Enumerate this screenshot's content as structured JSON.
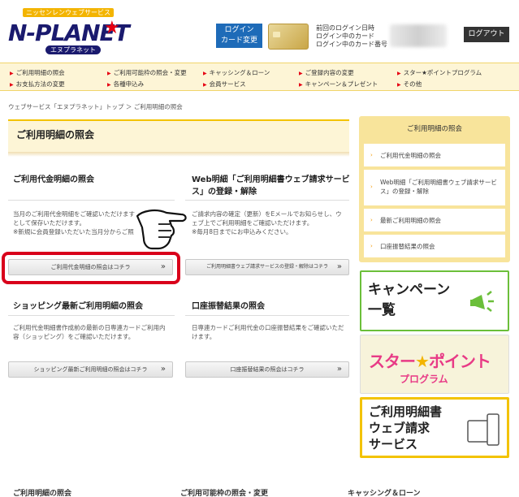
{
  "header": {
    "logo_tag": "ニッセンレンウェブサービス",
    "logo_main": "N-PLANET",
    "logo_sub": "エヌプラネット",
    "login_button": "ログイン\nカード変更",
    "account_info": [
      "前回のログイン日時",
      "ログイン中のカード",
      "ログイン中のカード番号"
    ],
    "logout_button": "ログアウト"
  },
  "nav": [
    {
      "label": "ご利用明細の照会"
    },
    {
      "label": "ご利用可能枠の照会・変更"
    },
    {
      "label": "キャッシング＆ローン"
    },
    {
      "label": "ご登録内容の変更"
    },
    {
      "label": "スター★ポイントプログラム"
    },
    {
      "label": "お支払方法の変更"
    },
    {
      "label": "各種申込み"
    },
    {
      "label": "会員サービス"
    },
    {
      "label": "キャンペーン＆プレゼント"
    },
    {
      "label": "その他"
    }
  ],
  "breadcrumb": "ウェブサービス「エヌプラネット」トップ ＞ ご利用明細の照会",
  "main": {
    "heading": "ご利用明細の照会",
    "sections": [
      {
        "title": "ご利用代金明細の照会",
        "desc": [
          "当月のご利用代金明細をご確認いただけます",
          "として保存いただけます。",
          "※新規に会員登録いただいた当月分からご照"
        ],
        "button": "ご利用代金明細の照会はコチラ"
      },
      {
        "title": "Web明細「ご利用明細書ウェブ請求サービス」の登録・解除",
        "desc": [
          "ご請求内容の確定（更新）をEメールでお知らせし、ウ",
          "ェブ上でご利用明細をご確認いただけます。",
          "※毎月8日までにお申込みください。"
        ],
        "button": "ご利用明細書ウェブ請求サービスの登録・解除はコチラ"
      },
      {
        "title": "ショッピング最新ご利用明細の照会",
        "desc": [
          "ご利用代金明細書作成前の最新の日専連カードご利用内",
          "容（ショッピング）をご確認いただけます。"
        ],
        "button": "ショッピング最新ご利用明細の照会はコチラ"
      },
      {
        "title": "口座振替結果の照会",
        "desc": [
          "日専連カードご利用代金の口座振替結果をご確認いただ",
          "けます。"
        ],
        "button": "口座振替結果の照会はコチラ"
      }
    ]
  },
  "sidebar": {
    "heading": "ご利用明細の照会",
    "items": [
      {
        "label": "ご利用代金明細の照会"
      },
      {
        "label": "Web明細「ご利用明細書ウェブ請求サービス」の登録・解除"
      },
      {
        "label": "最新ご利用明細の照会"
      },
      {
        "label": "口座振替結果の照会"
      }
    ]
  },
  "banners": {
    "campaign": [
      "キャンペーン",
      "一覧"
    ],
    "star_point": {
      "line1a": "スター",
      "line1b": "ポイント",
      "line2": "プログラム"
    },
    "web_bill": [
      "ご利用明細書",
      "ウェブ請求",
      "サービス"
    ]
  },
  "footer": [
    "ご利用明細の照会",
    "ご利用可能枠の照会・変更",
    "キャッシング＆ローン"
  ],
  "colors": {
    "accent_yellow": "#f3c300",
    "nav_bg": "#fdf5d6",
    "highlight_red": "#d9001b",
    "login_blue": "#1e6bb8"
  }
}
